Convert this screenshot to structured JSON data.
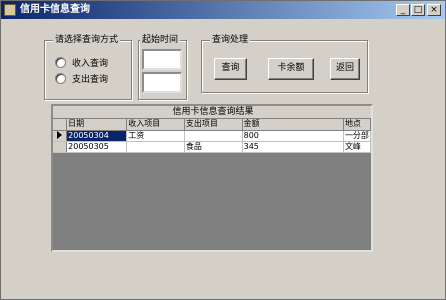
{
  "window": {
    "title": "信用卡信息查询",
    "icon": "app-icon",
    "controls": {
      "minimize": "_",
      "maximize": "□",
      "close": "×"
    }
  },
  "query_mode": {
    "legend": "请选择查询方式",
    "options": [
      {
        "label": "收入查询",
        "checked": false
      },
      {
        "label": "支出查询",
        "checked": false
      }
    ]
  },
  "start_time": {
    "legend": "起始时间",
    "field1_value": "",
    "field2_value": ""
  },
  "query_actions": {
    "legend": "查询处理",
    "buttons": [
      "查询",
      "卡余额",
      "返回"
    ]
  },
  "results": {
    "caption": "信用卡信息查询结果",
    "columns": [
      "日期",
      "收入项目",
      "支出项目",
      "金额",
      "地点"
    ],
    "rows": [
      {
        "cells": [
          "20050304",
          "工资",
          "",
          "800",
          "一分部"
        ],
        "current": true
      },
      {
        "cells": [
          "20050305",
          "",
          "食品",
          "345",
          "文峰"
        ],
        "current": false
      }
    ]
  }
}
